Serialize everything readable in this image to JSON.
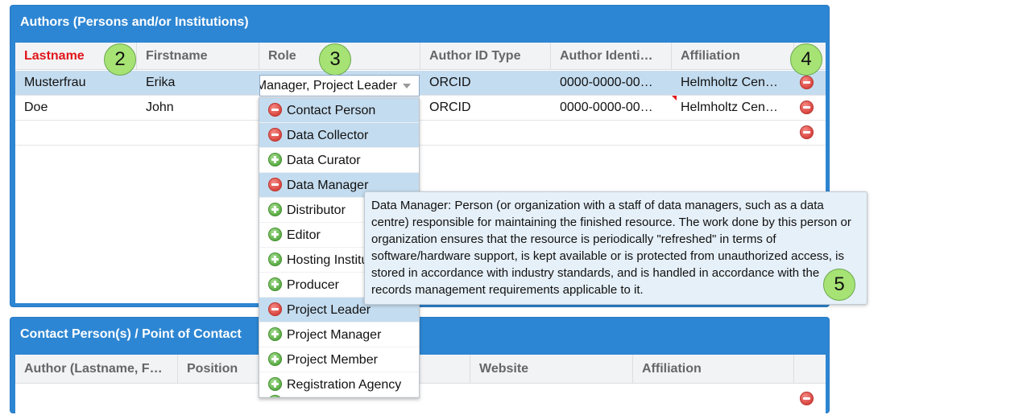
{
  "authors_panel": {
    "title": "Authors (Persons and/or Institutions)",
    "columns": [
      "Lastname",
      "Firstname",
      "Role",
      "Author ID Type",
      "Author Identi…",
      "Affiliation"
    ],
    "rows": [
      {
        "lastname": "Musterfrau",
        "firstname": "Erika",
        "role": "Data Manager, Project Leader",
        "id_type": "ORCID",
        "identifier": "0000-0000-00…",
        "affiliation": "Helmholtz Cen…"
      },
      {
        "lastname": "Doe",
        "firstname": "John",
        "role": "",
        "id_type": "ORCID",
        "identifier": "0000-0000-00…",
        "affiliation": "Helmholtz Cen…"
      }
    ]
  },
  "role_dropdown": {
    "items": [
      {
        "label": "Contact Person",
        "selected": true
      },
      {
        "label": "Data Collector",
        "selected": true
      },
      {
        "label": "Data Curator",
        "selected": false
      },
      {
        "label": "Data Manager",
        "selected": true
      },
      {
        "label": "Distributor",
        "selected": false
      },
      {
        "label": "Editor",
        "selected": false
      },
      {
        "label": "Hosting Institution",
        "selected": false
      },
      {
        "label": "Producer",
        "selected": false
      },
      {
        "label": "Project Leader",
        "selected": true
      },
      {
        "label": "Project Manager",
        "selected": false
      },
      {
        "label": "Project Member",
        "selected": false
      },
      {
        "label": "Registration Agency",
        "selected": false
      }
    ]
  },
  "tooltip": {
    "text": "Data Manager: Person (or organization with a staff of data managers, such as a data centre) responsible for maintaining the finished resource. The work done by this person or organization ensures that the resource is periodically \"refreshed\" in terms of software/hardware support, is kept available or is protected from unauthorized access, is stored in accordance with industry standards, and is handled in accordance with the records management requirements applicable to it."
  },
  "contact_panel": {
    "title": "Contact Person(s) / Point of Contact",
    "columns": [
      "Author (Lastname, F…",
      "Position",
      "",
      "Website",
      "Affiliation"
    ]
  },
  "badges": [
    "2",
    "3",
    "4",
    "5"
  ],
  "colors": {
    "header_blue": "#2d86d3",
    "required_red": "#e1151a",
    "selected_row": "#c4dcef",
    "badge_green": "#a6e374"
  }
}
